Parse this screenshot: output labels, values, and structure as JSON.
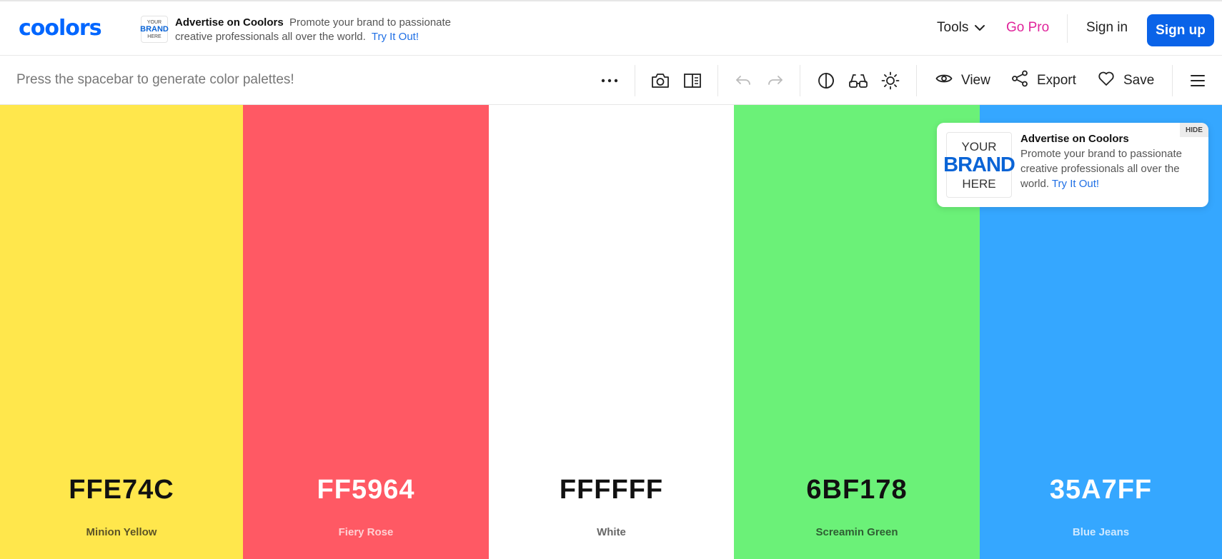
{
  "header": {
    "logo": "coolors",
    "ad": {
      "brand_line1": "YOUR",
      "brand_line2": "BRAND",
      "brand_line3": "HERE",
      "title": "Advertise on Coolors",
      "text_line1": "Promote your brand to passionate",
      "text_line2": "creative professionals all over the world.",
      "link": "Try It Out!"
    },
    "nav": {
      "tools": "Tools",
      "go_pro": "Go Pro",
      "sign_in": "Sign in",
      "sign_up": "Sign up"
    },
    "colors": {
      "brand": "#0066ff",
      "go_pro": "#e0249b",
      "sign_up_bg": "#0a63e8"
    }
  },
  "toolbar": {
    "hint": "Press the spacebar to generate color palettes!",
    "icons": [
      "more-icon",
      "camera-icon",
      "side-panel-icon",
      "undo-icon",
      "redo-icon",
      "contrast-icon",
      "glasses-icon",
      "brightness-icon",
      "view-icon",
      "share-icon",
      "heart-icon",
      "menu-icon"
    ],
    "view": "View",
    "export": "Export",
    "save": "Save"
  },
  "palette": [
    {
      "hex": "FFE74C",
      "name": "Minion Yellow",
      "bg": "#FFE74C",
      "hex_color": "#111111",
      "name_color": "#5c5326"
    },
    {
      "hex": "FF5964",
      "name": "Fiery Rose",
      "bg": "#FF5964",
      "hex_color": "#ffffff",
      "name_color": "#ffd0d3"
    },
    {
      "hex": "FFFFFF",
      "name": "White",
      "bg": "#FFFFFF",
      "hex_color": "#111111",
      "name_color": "#666666"
    },
    {
      "hex": "6BF178",
      "name": "Screamin Green",
      "bg": "#6BF178",
      "hex_color": "#111111",
      "name_color": "#2f5e33"
    },
    {
      "hex": "35A7FF",
      "name": "Blue Jeans",
      "bg": "#35A7FF",
      "hex_color": "#ffffff",
      "name_color": "#cfe9ff"
    }
  ],
  "ad_card": {
    "logo_line1": "YOUR",
    "logo_line2": "BRAND",
    "logo_line3": "HERE",
    "title": "Advertise on Coolors",
    "text": "Promote your brand to passionate creative professionals all over the world.",
    "link": "Try It Out!",
    "hide": "HIDE"
  }
}
